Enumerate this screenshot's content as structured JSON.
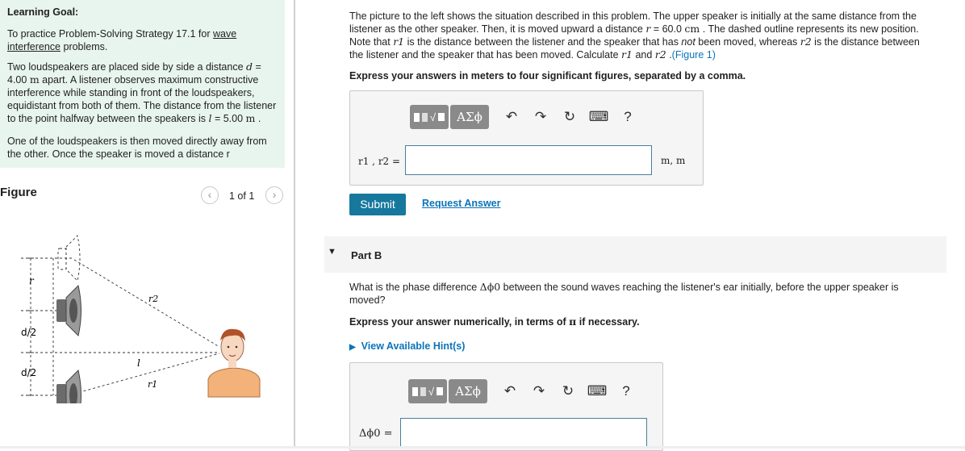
{
  "learning_goal": {
    "heading": "Learning Goal:",
    "p1_prefix": "To practice Problem-Solving Strategy 17.1 for ",
    "p1_link": "wave interference",
    "p1_suffix": " problems.",
    "p2_a": "Two loudspeakers are placed side by side a distance ",
    "p2_d": "d",
    "p2_b": " = 4.00 ",
    "p2_unit": "m",
    "p2_c": " apart. A listener observes maximum constructive interference while standing in front of the loudspeakers, equidistant from both of them. The distance from the listener to the point halfway between the speakers is ",
    "p2_l": "l",
    "p2_d2": " = 5.00 ",
    "p2_unit2": "m",
    "p2_end": " .",
    "p3": "One of the loudspeakers is then moved directly away from the other. Once the speaker is moved a distance r"
  },
  "figure": {
    "title": "Figure",
    "count": "1 of 1",
    "prev_icon": "chevron-left-icon",
    "next_icon": "chevron-right-icon",
    "labels": {
      "r": "r",
      "d_half_1": "d/2",
      "d_half_2": "d/2",
      "r2": "r2",
      "r1": "r1",
      "l": "l"
    }
  },
  "part_a": {
    "desc_1": "The picture to the left shows the situation described in this problem. The upper speaker is initially at the same distance from the",
    "desc_2a": "listener as the other speaker. Then, it is moved upward a distance ",
    "desc_2r": "r",
    "desc_2b": " = 60.0 ",
    "desc_2unit": "cm",
    "desc_2c": " . The dashed outline represents its new position.",
    "desc_3a": "Note that ",
    "desc_3r1": "r1",
    "desc_3b": " is the distance between the listener and the speaker that has ",
    "desc_3not": "not",
    "desc_3c": " been moved, whereas ",
    "desc_3r2": "r2",
    "desc_3d": " is the distance between",
    "desc_4a": "the listener and the speaker that has been moved. Calculate ",
    "desc_4r1": "r1",
    "desc_4and": " and ",
    "desc_4r2": "r2",
    "desc_4dot": " .",
    "desc_4link": "(Figure 1)",
    "instruction": "Express your answers in meters to four significant figures, separated by a comma.",
    "answer_label": "r1 , r2 =",
    "answer_value": "",
    "units": "m, m",
    "submit": "Submit",
    "request": "Request Answer"
  },
  "toolbar": {
    "greek": "ΑΣϕ",
    "help": "?",
    "icons": [
      "templates-icon",
      "greek-letters-icon",
      "undo-icon",
      "redo-icon",
      "reset-icon",
      "keyboard-icon",
      "help-icon"
    ]
  },
  "part_b": {
    "title": "Part B",
    "q1a": "What is the phase difference ",
    "q1sym": "Δϕ0",
    "q1b": " between the sound waves reaching the listener's ear initially, before the upper speaker is",
    "q2": "moved?",
    "instruction_a": "Express your answer numerically, in terms of ",
    "instruction_pi": "π",
    "instruction_b": " if necessary.",
    "hints": "View Available Hint(s)",
    "answer_label": "Δϕ0 =",
    "answer_value": ""
  },
  "colors": {
    "goal_bg": "#e8f5ee",
    "link": "#0b74b8",
    "submit_bg": "#16789c",
    "toolbar_btn": "#8a8a8a",
    "input_border": "#4a7f9c"
  }
}
